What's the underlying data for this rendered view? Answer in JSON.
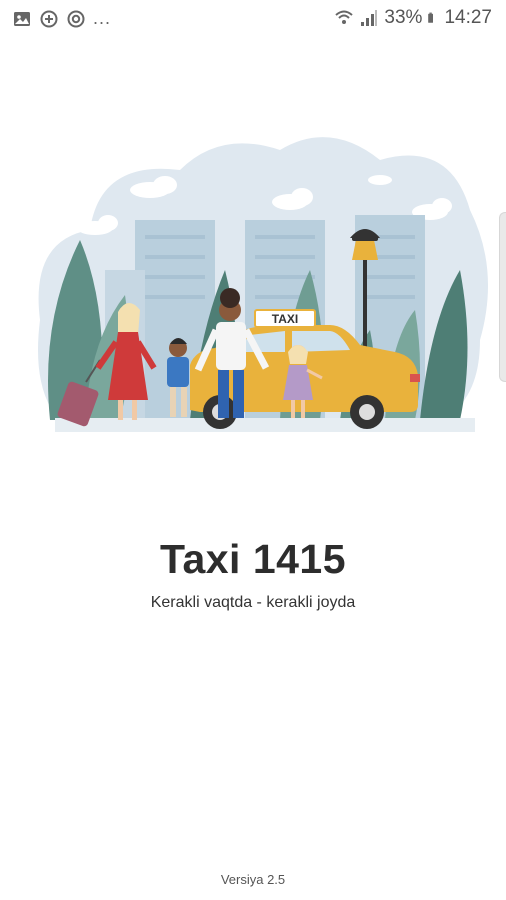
{
  "status_bar": {
    "left_icons": [
      "gallery-icon",
      "location-plus-icon",
      "sync-icon"
    ],
    "overflow": "...",
    "battery_percent": "33%",
    "time": "14:27",
    "right_icons": [
      "wifi-icon",
      "signal-icon",
      "battery-icon"
    ]
  },
  "illustration": {
    "taxi_sign": "TAXI"
  },
  "app": {
    "title": "Taxi 1415",
    "subtitle": "Kerakli vaqtda - kerakli joyda",
    "version": "Versiya 2.5"
  },
  "colors": {
    "taxi_yellow": "#e9b23c",
    "sky_blob": "#dfe8f0",
    "building": "#b9cfdd",
    "foliage": "#5f8f86",
    "text": "#2d2d2d"
  }
}
